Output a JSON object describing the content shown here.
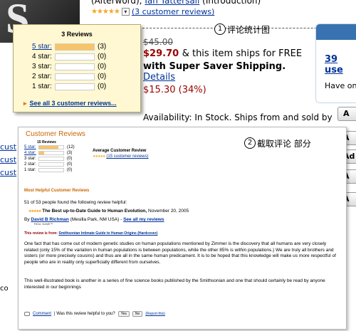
{
  "bg": {
    "cover_text": "S",
    "credit_text": "(Afterword),",
    "credit_link": "Ian Tattersall",
    "credit_after": "(Introduction)",
    "stars": "★★★★★",
    "stars_link": "(3 customer reviews)",
    "list_price": "$45.00",
    "price": "$29.70",
    "ship_text": "& this item ships for FREE",
    "ship_text2": "with Super Saver Shipping.",
    "details_link": "Details",
    "savings": "$15.30 (34%)",
    "availability": "Availability: In Stock. Ships from and sold by",
    "right_link": "39 use",
    "right_text": "Have on",
    "left_link_top": "cust",
    "left_link_bottom": "co"
  },
  "annotations": {
    "a1_num": "1",
    "a1_text": "评论统计图",
    "a2_num": "2",
    "a2_text": "截取评论 部分"
  },
  "popup": {
    "title": "3 Reviews",
    "rows": [
      {
        "label": "5 star:",
        "count": "(3)",
        "fraction": 1.0
      },
      {
        "label": "4 star:",
        "count": "(0)",
        "fraction": 0
      },
      {
        "label": "3 star:",
        "count": "(0)",
        "fraction": 0
      },
      {
        "label": "2 star:",
        "count": "(0)",
        "fraction": 0
      },
      {
        "label": "1 star:",
        "count": "(0)",
        "fraction": 0
      }
    ],
    "see_all": "See all 3 customer reviews..."
  },
  "panel": {
    "heading": "Customer Reviews",
    "review_count": "15 Reviews",
    "rows": [
      {
        "label": "5 star:",
        "count": "(12)",
        "fraction": 0.8
      },
      {
        "label": "4 star:",
        "count": "(3)",
        "fraction": 0.2
      },
      {
        "label": "3 star:",
        "count": "(0)",
        "fraction": 0
      },
      {
        "label": "2 star:",
        "count": "(0)",
        "fraction": 0
      },
      {
        "label": "1 star:",
        "count": "(0)",
        "fraction": 0
      }
    ],
    "avg_title": "Average Customer Review",
    "avg_stars": "★★★★★",
    "avg_link": "(15 customer reviews)",
    "most_helpful": "Most Helpful Customer Reviews",
    "helpful_count": "51 of 53 people found the following review helpful:",
    "review_stars": "★★★★★",
    "review_title": "The Best up-to-Date Guide to Human Evolution,",
    "review_date": "November 20, 2005",
    "by": "By",
    "author": "David B Richman",
    "location": "(Mesilla Park, NM USA) -",
    "see_all_reviews": "See all my reviews",
    "real_name": "REAL NAME™",
    "from_label": "This review is from:",
    "from_link": "Smithsonian Intimate Guide to Human Origins (Hardcover)",
    "para1": "One fact that has come out of modern genetic studies on human populations mentioned by Zimmer is the discovery that all humans are very closely related (only 15% of the variation in human populations is between populations, while the other 85% is within populations.) We are truly all brothers and sisters (or more precisely cousins) and thus are all in the same human predicament. It is to be hoped that this knowledge will make us more respectful of people who are in reality only superficially different from ourselves.",
    "para2": "This well-illustrated book is another in a series of fine science books published by the Smithsonian and one that should certainly be read by anyone interested in our beginnings",
    "comment": "Comment",
    "helpful_q": "| Was this review helpful to you?",
    "yes": "Yes",
    "no": "No",
    "report": "(Report this)"
  }
}
